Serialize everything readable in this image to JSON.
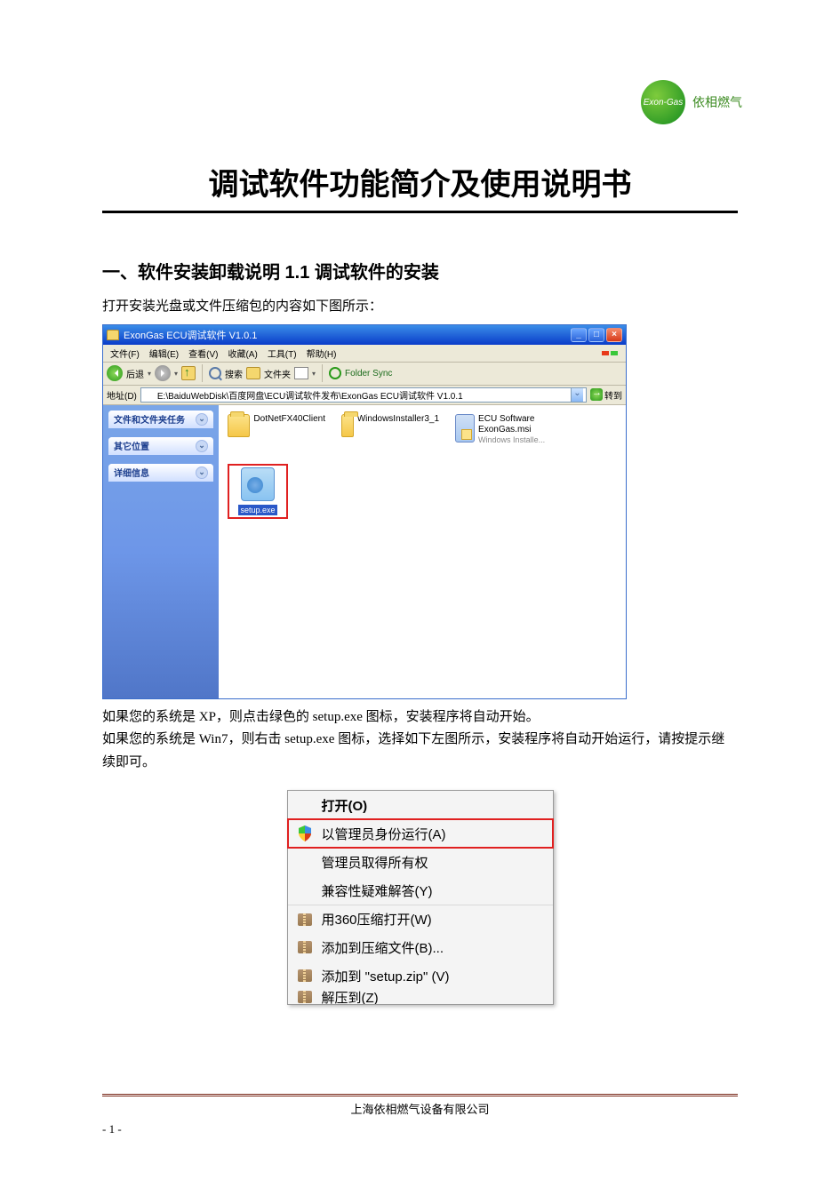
{
  "logo": {
    "badge": "Exon-Gas",
    "text": "依相燃气"
  },
  "doc": {
    "title": "调试软件功能简介及使用说明书",
    "section1_heading": "一、软件安装卸载说明 1.1 调试软件的安装",
    "intro_line": "打开安装光盘或文件压缩包的内容如下图所示：",
    "para_xp": "如果您的系统是 XP，则点击绿色的 setup.exe 图标，安装程序将自动开始。",
    "para_win7": "如果您的系统是 Win7，则右击 setup.exe 图标，选择如下左图所示，安装程序将自动开始运行，请按提示继续即可。"
  },
  "explorer": {
    "title": "ExonGas ECU调试软件 V1.0.1",
    "menu": [
      "文件(F)",
      "编辑(E)",
      "查看(V)",
      "收藏(A)",
      "工具(T)",
      "帮助(H)"
    ],
    "toolbar": {
      "back": "后退",
      "search": "搜索",
      "folders": "文件夹",
      "foldersync": "Folder Sync"
    },
    "address_label": "地址(D)",
    "address_path": "E:\\BaiduWebDisk\\百度网盘\\ECU调试软件发布\\ExonGas ECU调试软件 V1.0.1",
    "go": "转到",
    "side_panels": [
      "文件和文件夹任务",
      "其它位置",
      "详细信息"
    ],
    "files": {
      "f1": {
        "name": "DotNetFX40Client"
      },
      "f2": {
        "name": "WindowsInstaller3_1"
      },
      "f3": {
        "name": "ECU Software ExonGas.msi",
        "sub": "Windows Installe..."
      },
      "setup": {
        "name": "setup.exe"
      }
    }
  },
  "context_menu": {
    "items": [
      "打开(O)",
      "以管理员身份运行(A)",
      "管理员取得所有权",
      "兼容性疑难解答(Y)",
      "用360压缩打开(W)",
      "添加到压缩文件(B)...",
      "添加到 \"setup.zip\" (V)",
      "解压到(Z)"
    ]
  },
  "footer": {
    "company": "上海依相燃气设备有限公司",
    "page": "- 1 -"
  }
}
